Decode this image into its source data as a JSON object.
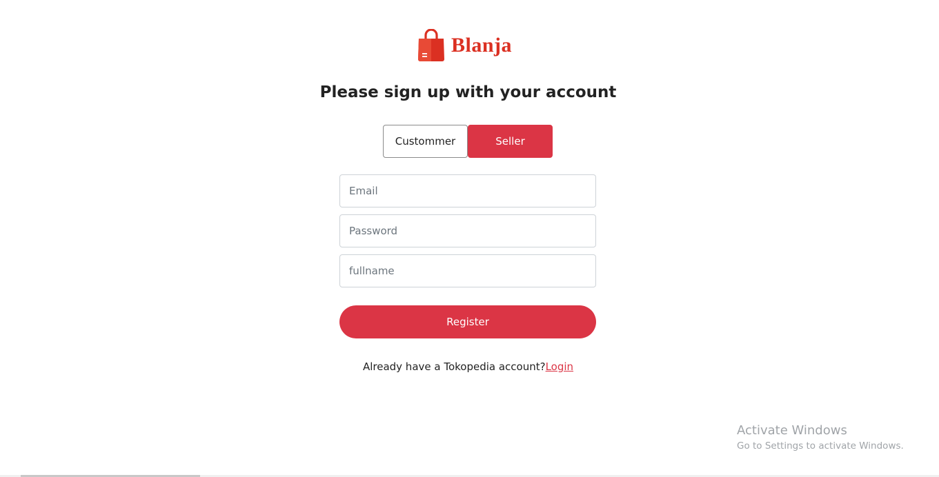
{
  "brand": {
    "name": "Blanja",
    "color": "#db3022",
    "icon": "shopping-bag-icon"
  },
  "heading": "Please sign up with your account",
  "roles": {
    "customer_label": "Custommer",
    "seller_label": "Seller",
    "selected": "Seller",
    "accent": "#db3545"
  },
  "form": {
    "email_placeholder": "Email",
    "password_placeholder": "Password",
    "fullname_placeholder": "fullname",
    "register_label": "Register"
  },
  "footer": {
    "prompt": "Already have a Tokopedia account?",
    "login_label": "Login"
  },
  "watermark": {
    "title": "Activate Windows",
    "subtitle": "Go to Settings to activate Windows."
  }
}
